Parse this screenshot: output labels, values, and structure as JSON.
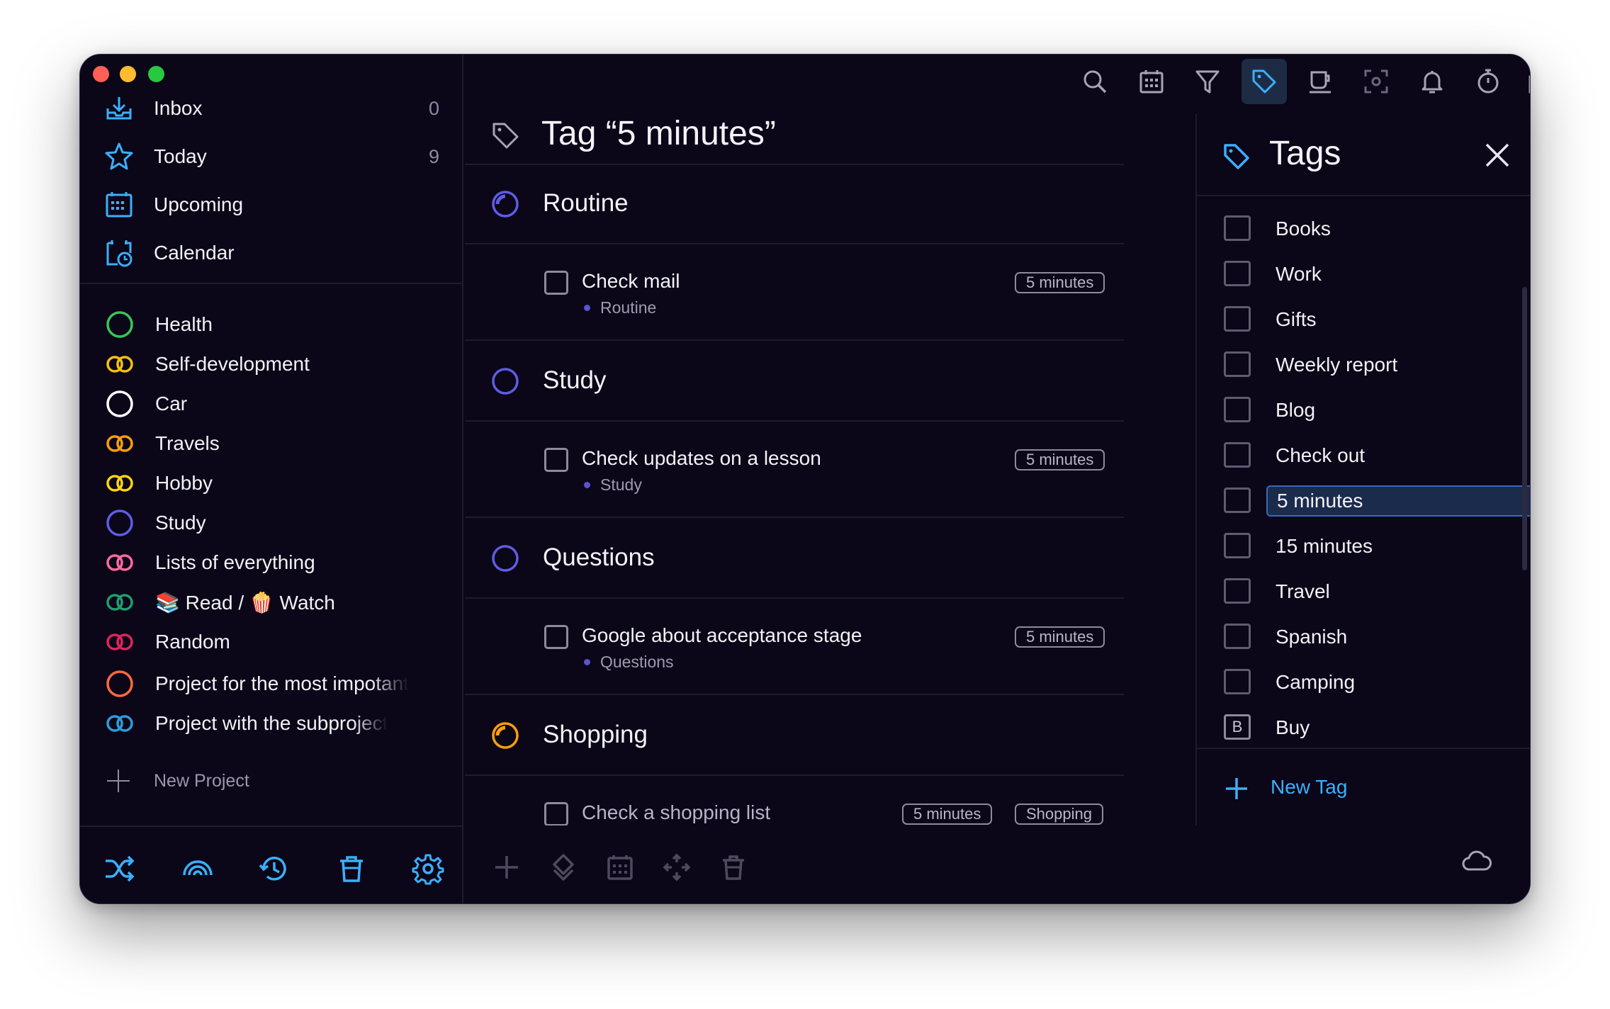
{
  "sidebar": {
    "nav": [
      {
        "label": "Inbox",
        "count": "0"
      },
      {
        "label": "Today",
        "count": "9"
      },
      {
        "label": "Upcoming",
        "count": ""
      },
      {
        "label": "Calendar",
        "count": ""
      }
    ],
    "projects": [
      {
        "label": "Health",
        "color": "#35c759"
      },
      {
        "label": "Self-development",
        "color": "#f5c20f"
      },
      {
        "label": "Car",
        "color": "#ffffff"
      },
      {
        "label": "Travels",
        "color": "#ff9f0a"
      },
      {
        "label": "Hobby",
        "color": "#ffd60a"
      },
      {
        "label": "Study",
        "color": "#5e5ce6"
      },
      {
        "label": "Lists of everything",
        "color": "#ff6b9d"
      },
      {
        "label": "📚 Read / 🍿 Watch",
        "color": "#1f9f6e"
      },
      {
        "label": "Random",
        "color": "#e0245e"
      },
      {
        "label": "Project for the most impotant",
        "color": "#ff6a3d"
      },
      {
        "label": "Project with the subproject",
        "color": "#2d9cdb"
      }
    ],
    "new_project": "New Project",
    "bottom_icons": [
      "shuffle-icon",
      "rainbow-icon",
      "history-icon",
      "trash-icon",
      "gear-icon"
    ]
  },
  "toolbar": {
    "icons": [
      "search-icon",
      "calendar-icon",
      "filter-icon",
      "tag-icon",
      "coffee-icon",
      "focus-icon",
      "bell-icon",
      "timer-icon",
      "copy-icon"
    ],
    "active": "tag-icon"
  },
  "main": {
    "title": "Tag “5 minutes”",
    "groups": [
      {
        "name": "Routine",
        "color": "#5e5ce6",
        "task": {
          "title": "Check mail",
          "project": "Routine",
          "tags": [
            "5 minutes"
          ]
        }
      },
      {
        "name": "Study",
        "color": "#5e5ce6",
        "task": {
          "title": "Check updates on a lesson",
          "project": "Study",
          "tags": [
            "5 minutes"
          ]
        }
      },
      {
        "name": "Questions",
        "color": "#5e5ce6",
        "task": {
          "title": "Google about acceptance stage",
          "project": "Questions",
          "tags": [
            "5 minutes"
          ]
        }
      },
      {
        "name": "Shopping",
        "color": "#ff9f0a",
        "task": {
          "title": "Check a shopping list",
          "project": "",
          "tags": [
            "5 minutes",
            "Shopping"
          ]
        }
      }
    ],
    "bottom_icons": [
      "plus-icon",
      "move-icon",
      "calendar-icon",
      "arrows-icon",
      "trash-icon"
    ]
  },
  "tags_panel": {
    "title": "Tags",
    "tags": [
      {
        "label": "Books",
        "mark": ""
      },
      {
        "label": "Work",
        "mark": ""
      },
      {
        "label": "Gifts",
        "mark": ""
      },
      {
        "label": "Weekly report",
        "mark": ""
      },
      {
        "label": "Blog",
        "mark": ""
      },
      {
        "label": "Check out",
        "mark": ""
      },
      {
        "label": "5 minutes",
        "mark": "",
        "selected": true
      },
      {
        "label": "15 minutes",
        "mark": ""
      },
      {
        "label": "Travel",
        "mark": ""
      },
      {
        "label": "Spanish",
        "mark": ""
      },
      {
        "label": "Camping",
        "mark": ""
      },
      {
        "label": "Buy",
        "mark": "B"
      }
    ],
    "new_tag": "New Tag"
  },
  "colors": {
    "accent": "#3ab0ff",
    "background": "#0b0618",
    "selected_tag": "#1a2b4c"
  }
}
